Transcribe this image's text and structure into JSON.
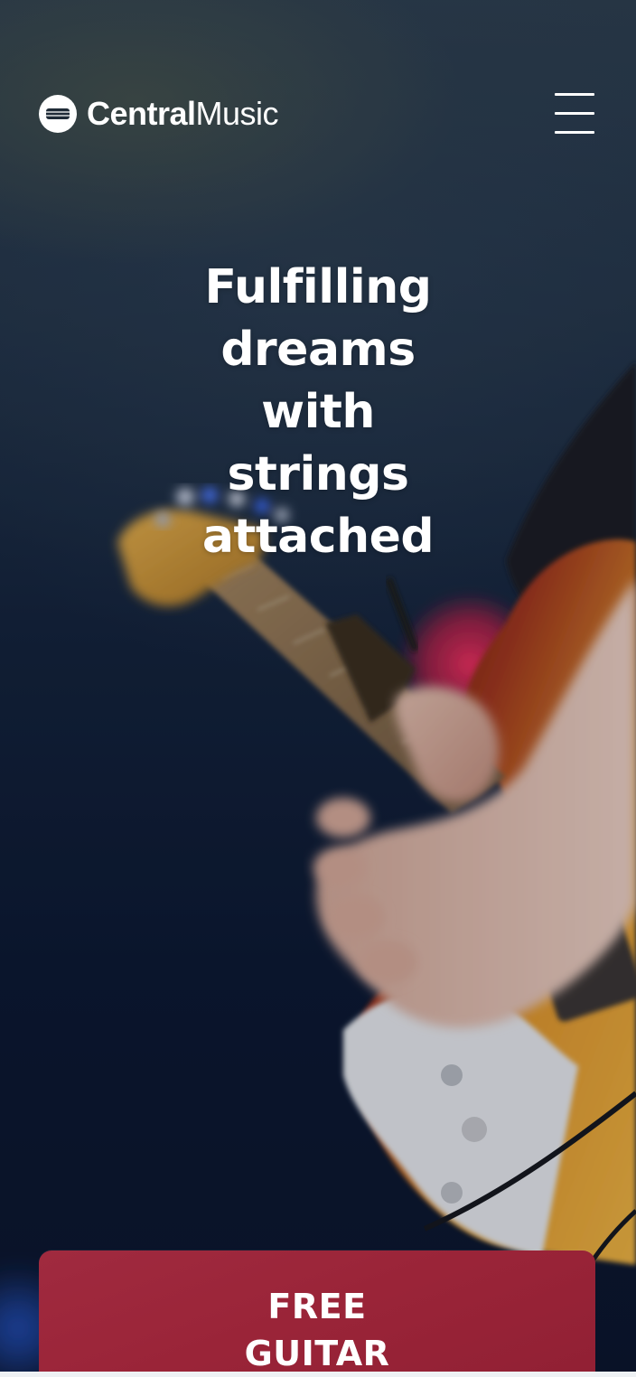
{
  "brand": {
    "name_bold": "Central",
    "name_light": "Music",
    "logo_icon": "guitar-pick-logo-icon"
  },
  "header": {
    "menu_icon": "hamburger-menu-icon"
  },
  "hero": {
    "headline_lines": [
      "Fulfilling",
      "dreams",
      "with",
      "strings",
      "attached"
    ],
    "image": "electric-guitar-player-photo"
  },
  "cta": {
    "lines": [
      "FREE",
      "GUITAR"
    ]
  },
  "colors": {
    "cta_background": "#9a2438",
    "text": "#ffffff",
    "background_dark": "#0c1830"
  }
}
